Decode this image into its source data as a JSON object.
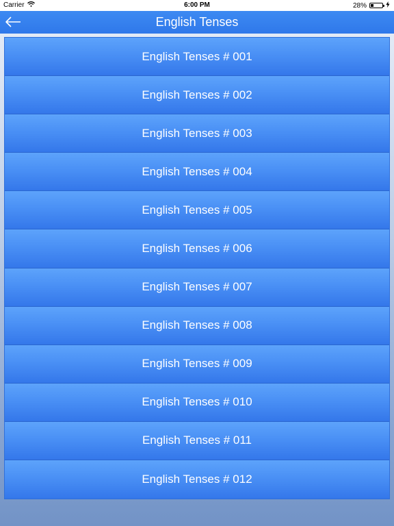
{
  "status_bar": {
    "carrier": "Carrier",
    "time": "6:00 PM",
    "battery_percent": "28%",
    "battery_level": 0.28
  },
  "nav": {
    "title": "English Tenses",
    "back_icon": "back-arrow-icon"
  },
  "list": {
    "items": [
      {
        "label": "English Tenses # 001"
      },
      {
        "label": "English Tenses # 002"
      },
      {
        "label": "English Tenses # 003"
      },
      {
        "label": "English Tenses # 004"
      },
      {
        "label": "English Tenses # 005"
      },
      {
        "label": "English Tenses # 006"
      },
      {
        "label": "English Tenses # 007"
      },
      {
        "label": "English Tenses # 008"
      },
      {
        "label": "English Tenses # 009"
      },
      {
        "label": "English Tenses # 010"
      },
      {
        "label": "English Tenses # 011"
      },
      {
        "label": "English Tenses # 012"
      }
    ]
  },
  "colors": {
    "nav_background": "#3d8af2",
    "list_item_top": "#5da3fb",
    "list_item_bottom": "#3477ea",
    "text": "#ffffff"
  }
}
